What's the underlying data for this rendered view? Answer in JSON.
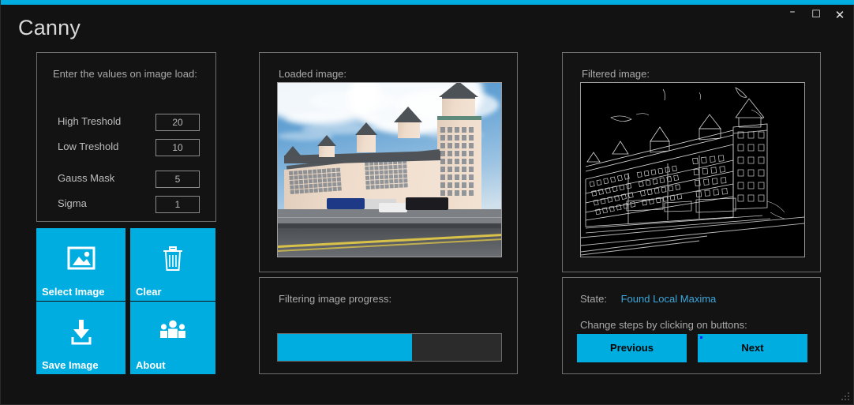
{
  "window": {
    "title": "Canny",
    "accent_color": "#00ADE0",
    "background_color": "#121212",
    "controls": [
      {
        "name": "minimize",
        "glyph": "–"
      },
      {
        "name": "maximize",
        "glyph": "☐"
      },
      {
        "name": "close",
        "glyph": "✕"
      }
    ]
  },
  "settings": {
    "heading": "Enter the values on image load:",
    "fields": [
      {
        "label": "High Treshold",
        "value": "20"
      },
      {
        "label": "Low Treshold",
        "value": "10"
      },
      {
        "label": "Gauss Mask",
        "value": "5"
      },
      {
        "label": "Sigma",
        "value": "1"
      }
    ]
  },
  "tiles": [
    {
      "label": "Select Image",
      "icon": "image-icon"
    },
    {
      "label": "Clear",
      "icon": "trash-icon"
    },
    {
      "label": "Save Image",
      "icon": "download-icon"
    },
    {
      "label": "About",
      "icon": "people-icon"
    }
  ],
  "loaded": {
    "label": "Loaded image:",
    "image_description": "Photograph of a large beige multi-storey hotel building with towers under a blue cloudy sky, tour buses parked in front and a road with a yellow centre line"
  },
  "filtered": {
    "label": "Filtered image:",
    "image_description": "Canny edge-detection result of the hotel photograph: white outlines on a black background"
  },
  "progress": {
    "label": "Filtering image progress:",
    "percent": 60
  },
  "state": {
    "caption": "State:",
    "value": "Found Local Maxima",
    "value_color": "#3BA7DB",
    "hint": "Change steps by clicking on buttons:",
    "previous_label": "Previous",
    "next_label": "Next"
  }
}
